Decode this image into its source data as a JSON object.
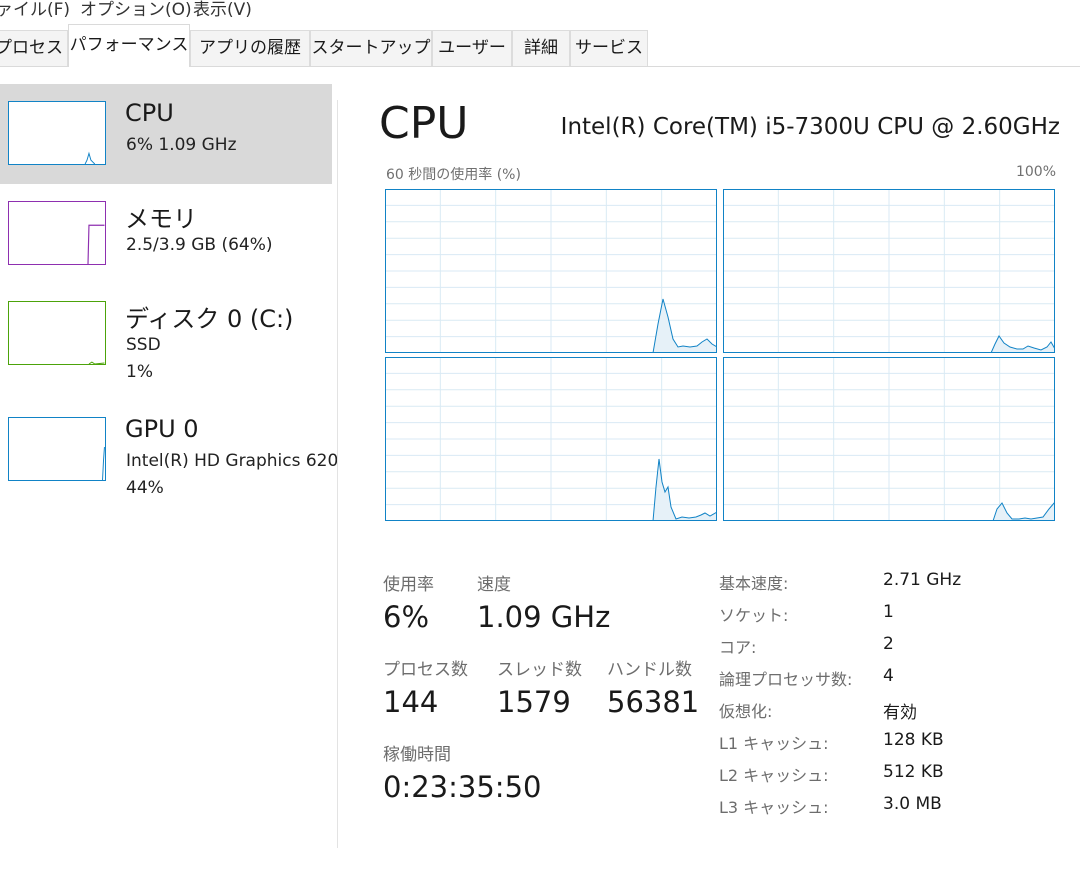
{
  "menu": [
    {
      "label": "ァイル(F)"
    },
    {
      "label": "オプション(O)"
    },
    {
      "label": "表示(V)"
    }
  ],
  "tabs": [
    {
      "label": "プロセス",
      "active": false
    },
    {
      "label": "パフォーマンス",
      "active": true
    },
    {
      "label": "アプリの履歴",
      "active": false
    },
    {
      "label": "スタートアップ",
      "active": false
    },
    {
      "label": "ユーザー",
      "active": false
    },
    {
      "label": "詳細",
      "active": false
    },
    {
      "label": "サービス",
      "active": false
    }
  ],
  "sidebar": {
    "items": [
      {
        "title": "CPU",
        "sub1": "6%  1.09 GHz",
        "sub2": "",
        "color": "#1183c6",
        "selected": true
      },
      {
        "title": "メモリ",
        "sub1": "2.5/3.9 GB (64%)",
        "sub2": "",
        "color": "#8e2fb0",
        "selected": false
      },
      {
        "title": "ディスク 0 (C:)",
        "sub1": "SSD",
        "sub2": "1%",
        "color": "#4ca30a",
        "selected": false
      },
      {
        "title": "GPU 0",
        "sub1": "Intel(R) HD Graphics 620",
        "sub2": "44%",
        "color": "#1183c6",
        "selected": false
      }
    ]
  },
  "main": {
    "title": "CPU",
    "model": "Intel(R) Core(TM) i5-7300U CPU @ 2.60GHz",
    "graph_caption": "60 秒間の使用率 (%)",
    "graph_max": "100%",
    "accent_color": "#1183c6",
    "grid_color": "#d9eaf4"
  },
  "stats": {
    "usage_label": "使用率",
    "usage_value": "6%",
    "speed_label": "速度",
    "speed_value": "1.09 GHz",
    "processes_label": "プロセス数",
    "processes_value": "144",
    "threads_label": "スレッド数",
    "threads_value": "1579",
    "handles_label": "ハンドル数",
    "handles_value": "56381",
    "uptime_label": "稼働時間",
    "uptime_value": "0:23:35:50"
  },
  "specs": [
    {
      "label": "基本速度:",
      "value": "2.71 GHz"
    },
    {
      "label": "ソケット:",
      "value": "1"
    },
    {
      "label": "コア:",
      "value": "2"
    },
    {
      "label": "論理プロセッサ数:",
      "value": "4"
    },
    {
      "label": "仮想化:",
      "value": "有効"
    },
    {
      "label": "L1 キャッシュ:",
      "value": "128 KB"
    },
    {
      "label": "L2 キャッシュ:",
      "value": "512 KB"
    },
    {
      "label": "L3 キャッシュ:",
      "value": "3.0 MB"
    }
  ]
}
